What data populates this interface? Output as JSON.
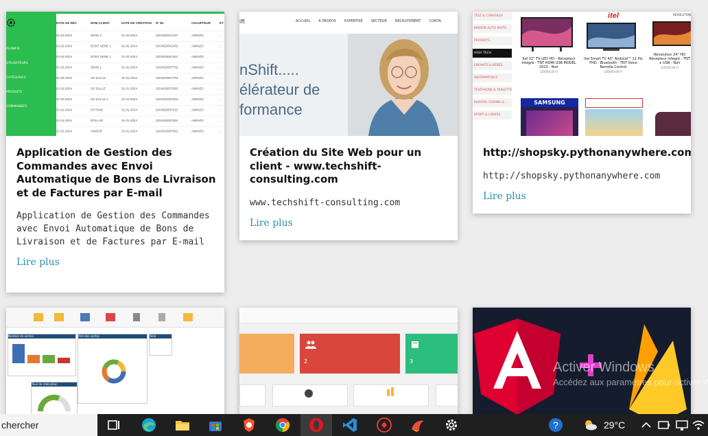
{
  "cards": [
    {
      "title": "Application de Gestion des Commandes avec Envoi Automatique de Bons de Livraison et de Factures par E-mail",
      "description": "Application de Gestion des Commandes avec Envoi Automatique de Bons de Livraison et de Factures par E-mail",
      "link": "Lire plus",
      "thumb": {
        "sidebar_items": [
          "PLANIFIE",
          "UTILISATEURS",
          "CATÉGORIES",
          "PRODUITS",
          "COMMANDES"
        ],
        "headers": [
          "DATE DE RÉC",
          "NOM CLIENT",
          "DATE DE CRÉATION",
          "N° BL",
          "CHAUFFEUR",
          "ÉT"
        ],
        "rows": [
          [
            "01-02-2024",
            "SENE 2",
            "01-02-2024",
            "2024020041157",
            "AWINZO",
            "..."
          ],
          [
            "02-02-2024",
            "DONT SENE 1",
            "01-02-2024",
            "2024020041602",
            "AWINZO",
            "..."
          ],
          [
            "02-02-2024",
            "DONT SENE 1",
            "01-02-2024",
            "2024020041601",
            "AWINZO",
            "..."
          ],
          [
            "01-02-2024",
            "SENE 1",
            "01-02-2024",
            "2024020037702",
            "AWINZO",
            "..."
          ],
          [
            "01-02-2024",
            "SO DALLE",
            "31-01-2024",
            "2024020037704",
            "AWINZO",
            "..."
          ],
          [
            "01-02-2024",
            "SO DALLE",
            "31-01-2024",
            "2024020037603",
            "AWINZO",
            "..."
          ],
          [
            "01-02-2024",
            "SO DALLE 2",
            "31-01-2024",
            "2024020037603",
            "AWINZO",
            "..."
          ],
          [
            "31-01-2024",
            "OCTANE",
            "31-01-2024",
            "2024020037622",
            "AWINZO",
            "..."
          ],
          [
            "31-01-2024",
            "DOLLAR",
            "31-01-2024",
            "2024020037602",
            "AWINZO",
            "..."
          ],
          [
            "31-01-2024",
            "AMOUR",
            "31-01-2024",
            "2024020037601",
            "AWINZO",
            "..."
          ],
          [
            "31-01-2024",
            "SENE",
            "31-01-2024",
            "2024020037600",
            "AWINZO",
            "..."
          ]
        ]
      }
    },
    {
      "title": "Création du Site Web pour un client - www.techshift-consulting.com",
      "description": "www.techshift-consulting.com",
      "link": "Lire plus",
      "thumb": {
        "nav": [
          "ACCUEIL",
          "À PROPOS",
          "EXPERTISE",
          "SECTEUR",
          "RECRUTEMENT",
          "CONTA"
        ],
        "logo": "ift",
        "hero_line1": "nShift.....",
        "hero_line2": "élérateur de",
        "hero_line3": "formance"
      }
    },
    {
      "title": "http://shopsky.pythonanywhere.com",
      "description": "http://shopsky.pythonanywhere.com",
      "link": "Lire plus",
      "thumb": {
        "categories": [
          "TÉLÉ & CONSOLES",
          "MAISON AUTO MOTO",
          "PRODUITS",
          "HIGH TECH",
          "ENFANTS & BÉBÉS",
          "INFORMATIQUE",
          "TÉLÉPHONE & TABLETTE",
          "MAISON, CUISINE & ...",
          "SPORT & LOISIRS"
        ],
        "products": [
          {
            "name": "Itel 32\" TV LED HD - Récepteur Intégré - TNT HDMI USB MODEL 2023 - Noir",
            "price": "120000.00 Fr"
          },
          {
            "name": "Itel Smart TV 43\" Android™ 11 Pix FHD - Bluetooth - TNT Voice Remote Control",
            "price": "185000.00 Fr"
          },
          {
            "name": "Revolution 24\" HD Récepteur intégré - TNT + USB - Noir",
            "price": "125000.00 Fr"
          }
        ],
        "brand": "itel",
        "brand2": "REVOLUTION",
        "samsung": "SAMSUNG"
      }
    }
  ],
  "bottom_cards": {
    "dashboard_labels": [
      "Nombre de ventes",
      "Part des ventes",
      "Total",
      "Taux de réalisation"
    ],
    "stat2_value": "2",
    "stat3_value": "3"
  },
  "watermark": {
    "line1": "Activer Windows",
    "line2": "Accédez aux paramètres pour activer Windows."
  },
  "taskbar": {
    "search_text": "chercher",
    "weather": "29°C",
    "icons": [
      "task-view-icon",
      "edge-icon",
      "file-explorer-icon",
      "store-icon",
      "brave-icon",
      "chrome-icon",
      "opera-icon",
      "vscode-icon",
      "app-icon",
      "app-icon-2",
      "settings-icon"
    ]
  },
  "colors": {
    "accent_green": "#2bbd4f",
    "link_blue": "#2a8fae",
    "angular_red": "#dd0031",
    "firebase_yellow": "#ffca28",
    "taskbar": "#1f1f1f"
  }
}
